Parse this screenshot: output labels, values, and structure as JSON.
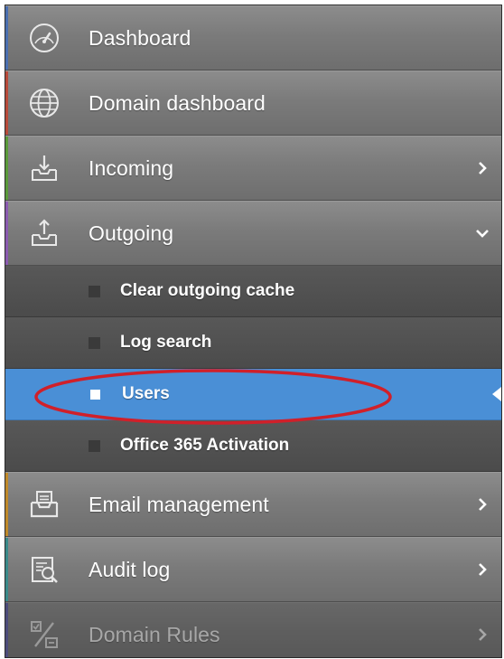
{
  "menu": {
    "items": [
      {
        "label": "Dashboard",
        "icon": "dashboard-gauge-icon",
        "accent": "#4a6fb0"
      },
      {
        "label": "Domain dashboard",
        "icon": "globe-icon",
        "accent": "#b84a3a"
      },
      {
        "label": "Incoming",
        "icon": "inbox-download-icon",
        "accent": "#5a9a3a",
        "chevron": "chevron-right-icon"
      },
      {
        "label": "Outgoing",
        "icon": "outbox-upload-icon",
        "accent": "#8a5ab0",
        "chevron": "chevron-down-icon"
      }
    ],
    "submenu": [
      {
        "label": "Clear outgoing cache",
        "active": false
      },
      {
        "label": "Log search",
        "active": false
      },
      {
        "label": "Users",
        "active": true
      },
      {
        "label": "Office 365 Activation",
        "active": false
      }
    ],
    "items_after": [
      {
        "label": "Email management",
        "icon": "email-tray-icon",
        "accent": "#c08a2a",
        "chevron": "chevron-right-icon"
      },
      {
        "label": "Audit log",
        "icon": "audit-log-icon",
        "accent": "#3a8a8a",
        "chevron": "chevron-right-icon"
      },
      {
        "label": "Domain Rules",
        "icon": "domain-rules-icon",
        "accent": "#5a5ab0",
        "chevron": "chevron-right-icon"
      }
    ]
  },
  "highlight": {
    "color": "#d0202a"
  },
  "colors": {
    "active_bg": "#4a8fd6",
    "menu_bg": "#7b7b7b",
    "submenu_bg": "#4f4f4f"
  }
}
